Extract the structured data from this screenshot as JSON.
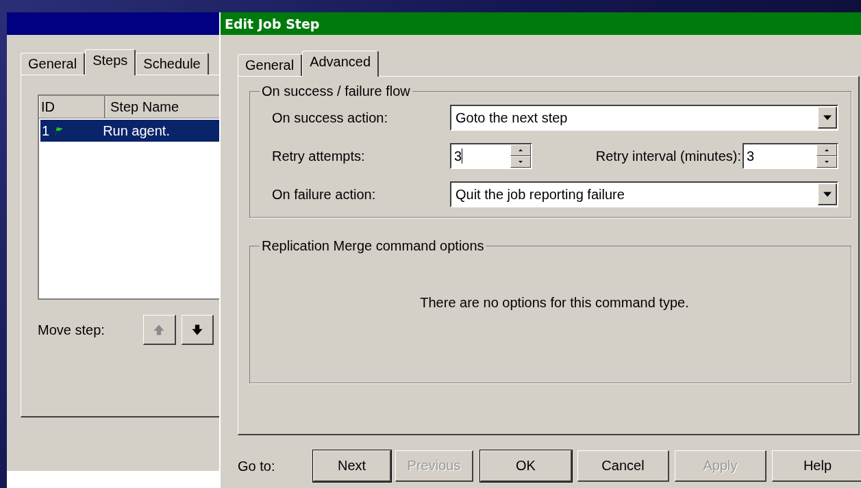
{
  "back_window": {
    "tabs": [
      {
        "label": "General",
        "selected": false
      },
      {
        "label": "Steps",
        "selected": true
      },
      {
        "label": "Schedule",
        "selected": false
      }
    ],
    "steps_table": {
      "columns": [
        "ID",
        "Step Name"
      ],
      "rows": [
        {
          "id": "1",
          "name": "Run agent.",
          "selected": true
        }
      ]
    },
    "move_step": {
      "label": "Move step:",
      "buttons": [
        {
          "kind": "up",
          "disabled": true
        },
        {
          "kind": "down",
          "disabled": false
        }
      ]
    }
  },
  "dialog": {
    "title": "Edit Job Step",
    "tabs": [
      {
        "label": "General",
        "selected": false
      },
      {
        "label": "Advanced",
        "selected": true
      }
    ],
    "flow_group": {
      "title": "On success / failure flow",
      "success_action": {
        "label": "On success action:",
        "value": "Goto the next step"
      },
      "retry_attempts": {
        "label": "Retry attempts:",
        "value": "3"
      },
      "retry_interval": {
        "label": "Retry interval (minutes):",
        "value": "3"
      },
      "failure_action": {
        "label": "On failure action:",
        "value": "Quit the job reporting failure"
      }
    },
    "options_group": {
      "title": "Replication Merge command options",
      "message": "There are no options for this command type."
    },
    "footer": {
      "goto_label": "Go to:",
      "goto_buttons": [
        {
          "label": "Next",
          "disabled": false,
          "default": true
        },
        {
          "label": "Previous",
          "disabled": true,
          "default": false
        }
      ],
      "action_buttons": [
        {
          "label": "OK",
          "disabled": false,
          "default": true
        },
        {
          "label": "Cancel",
          "disabled": false,
          "default": false
        },
        {
          "label": "Apply",
          "disabled": true,
          "default": false
        },
        {
          "label": "Help",
          "disabled": false,
          "default": false
        }
      ]
    }
  }
}
